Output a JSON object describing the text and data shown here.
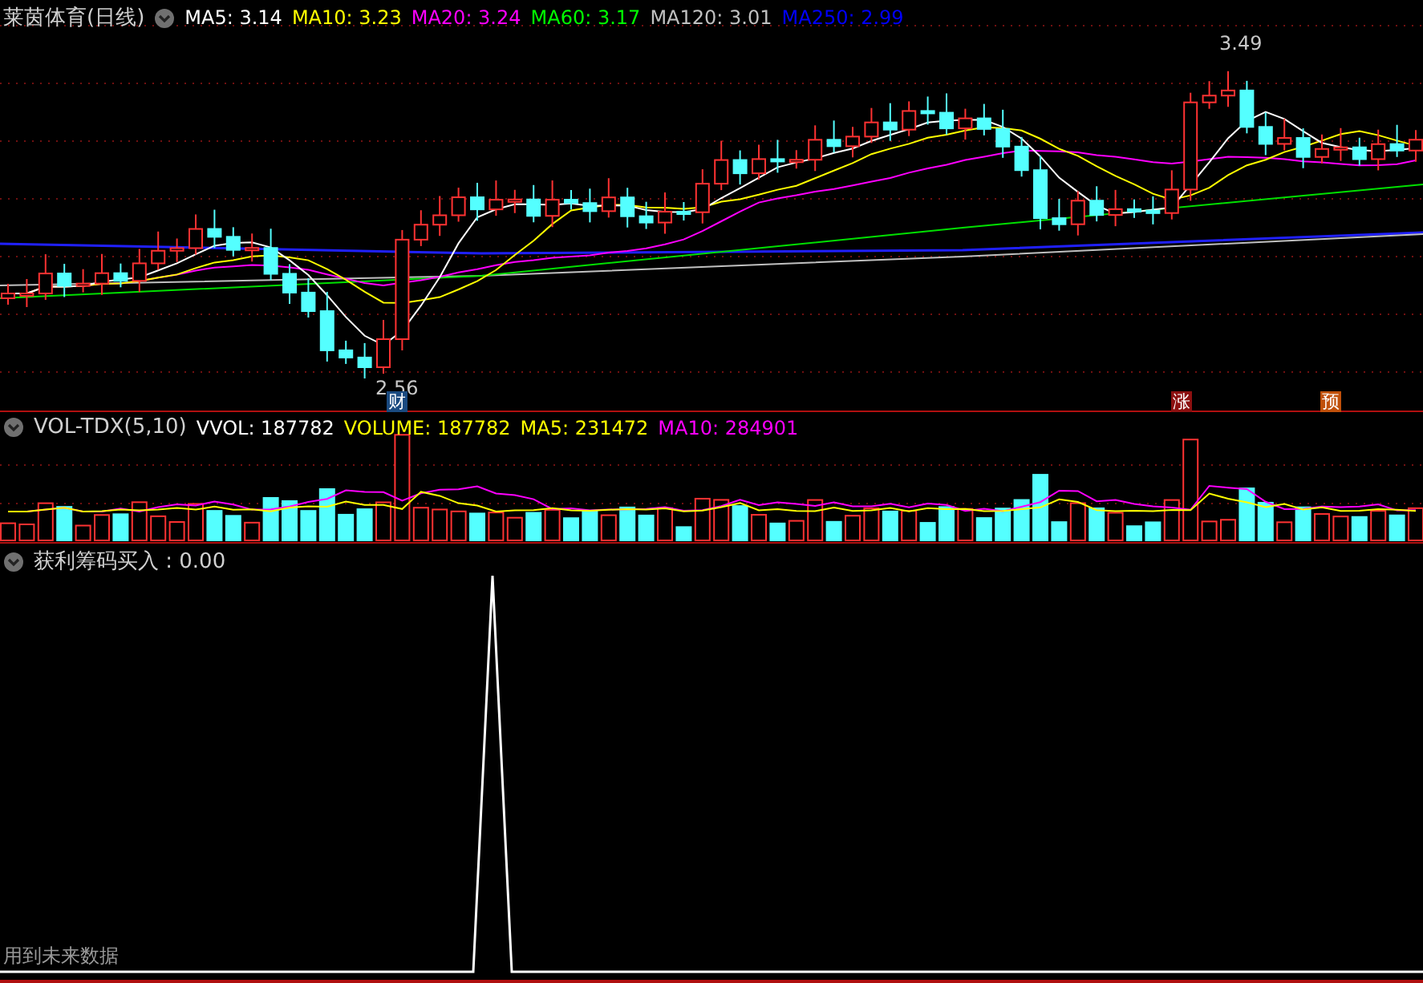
{
  "main_panel": {
    "title": "莱茵体育(日线)",
    "readings": [
      {
        "text": "MA5: 3.14",
        "color": "#ffffff"
      },
      {
        "text": "MA10: 3.23",
        "color": "#ffff00"
      },
      {
        "text": "MA20: 3.24",
        "color": "#ff00ff"
      },
      {
        "text": "MA60: 3.17",
        "color": "#00ff00"
      },
      {
        "text": "MA120: 3.01",
        "color": "#c0c0c0"
      },
      {
        "text": "MA250: 2.99",
        "color": "#0000ff"
      }
    ],
    "price_marks": [
      {
        "text": "3.49"
      },
      {
        "text": "2.56"
      }
    ],
    "event_badges": [
      {
        "text": "财",
        "color": "#1a4a80"
      },
      {
        "text": "涨",
        "color": "#8c1010"
      },
      {
        "text": "预",
        "color": "#c0500a"
      }
    ]
  },
  "volume_panel": {
    "title": "VOL-TDX(5,10)",
    "readings": [
      {
        "text": "VVOL: 187782",
        "color": "#ffffff"
      },
      {
        "text": "VOLUME: 187782",
        "color": "#ffff00"
      },
      {
        "text": "MA5: 231472",
        "color": "#ffff00"
      },
      {
        "text": "MA10: 284901",
        "color": "#ff00ff"
      }
    ]
  },
  "indicator_panel": {
    "title": "获利筹码买入 : 0.00"
  },
  "footer_note": "用到未来数据"
}
